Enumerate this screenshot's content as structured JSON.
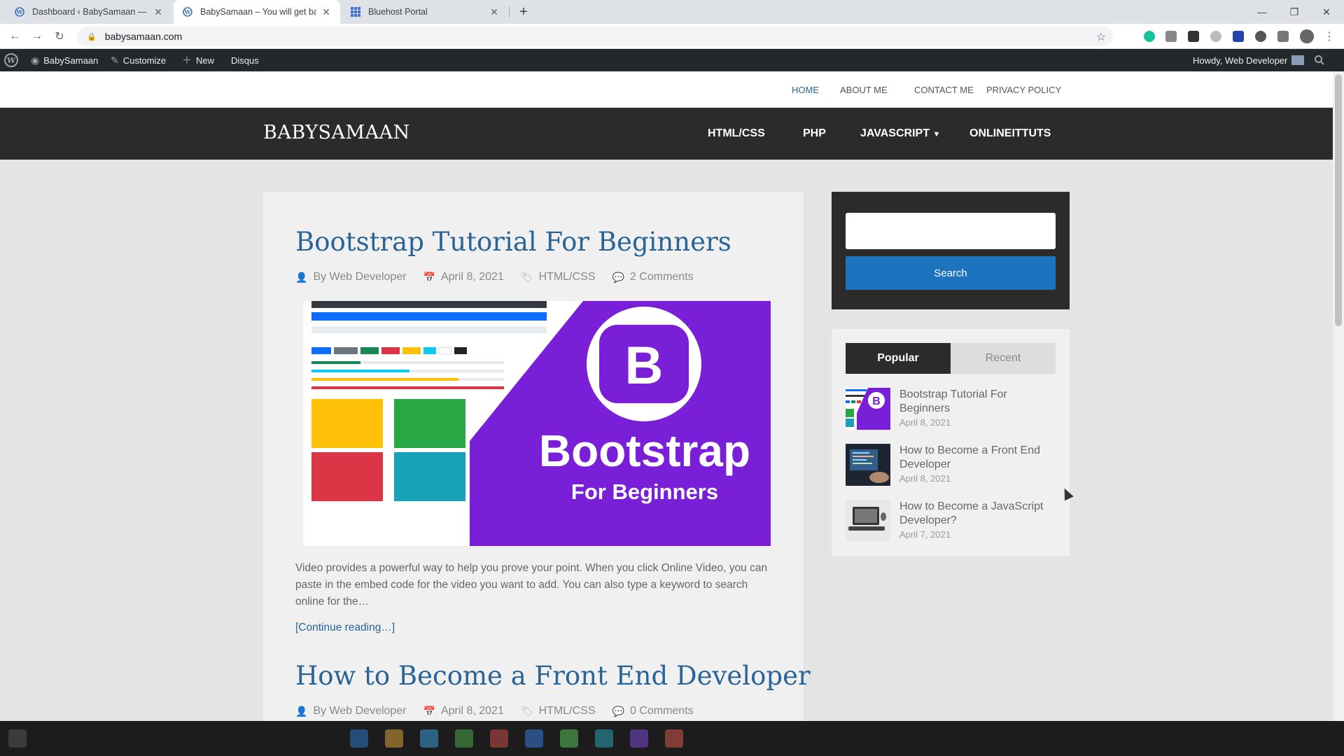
{
  "browser": {
    "tabs": [
      {
        "title": "Dashboard ‹ BabySamaan — Wo",
        "active": false
      },
      {
        "title": "BabySamaan – You will get baby",
        "active": true
      },
      {
        "title": "Bluehost Portal",
        "active": false
      }
    ],
    "url": "babysamaan.com"
  },
  "adminbar": {
    "site": "BabySamaan",
    "customize": "Customize",
    "new": "New",
    "disqus": "Disqus",
    "howdy": "Howdy, Web Developer"
  },
  "top_menu": [
    "HOME",
    "ABOUT ME",
    "CONTACT ME",
    "PRIVACY POLICY"
  ],
  "brand": "BABYSAMAAN",
  "main_nav": [
    "HTML/CSS",
    "PHP",
    "JAVASCRIPT",
    "ONLINEITTUTS"
  ],
  "posts": [
    {
      "title": "Bootstrap Tutorial For Beginners",
      "author": "By Web Developer",
      "date": "April 8, 2021",
      "category": "HTML/CSS",
      "comments": "2 Comments",
      "thumb_title": "Bootstrap",
      "thumb_subtitle": "For Beginners",
      "thumb_letter": "B",
      "excerpt": "Video provides a powerful way to help you prove your point. When you click Online Video, you can paste in the embed code for the video you want to add. You can also type a keyword to search online for the…",
      "read_more": "[Continue reading…]"
    },
    {
      "title": "How to Become a Front End Developer",
      "author": "By Web Developer",
      "date": "April 8, 2021",
      "category": "HTML/CSS",
      "comments": "0 Comments"
    }
  ],
  "sidebar": {
    "search_button": "Search",
    "tabs": [
      "Popular",
      "Recent"
    ],
    "items": [
      {
        "title": "Bootstrap Tutorial For Beginners",
        "date": "April 8, 2021"
      },
      {
        "title": "How to Become a Front End Developer",
        "date": "April 8, 2021"
      },
      {
        "title": "How to Become a JavaScript Developer?",
        "date": "April 7, 2021"
      }
    ]
  },
  "colors": {
    "link": "#2a6496",
    "dark": "#2b2b2b",
    "search_button": "#1e73be",
    "bootstrap_purple": "#7a1fd8"
  }
}
